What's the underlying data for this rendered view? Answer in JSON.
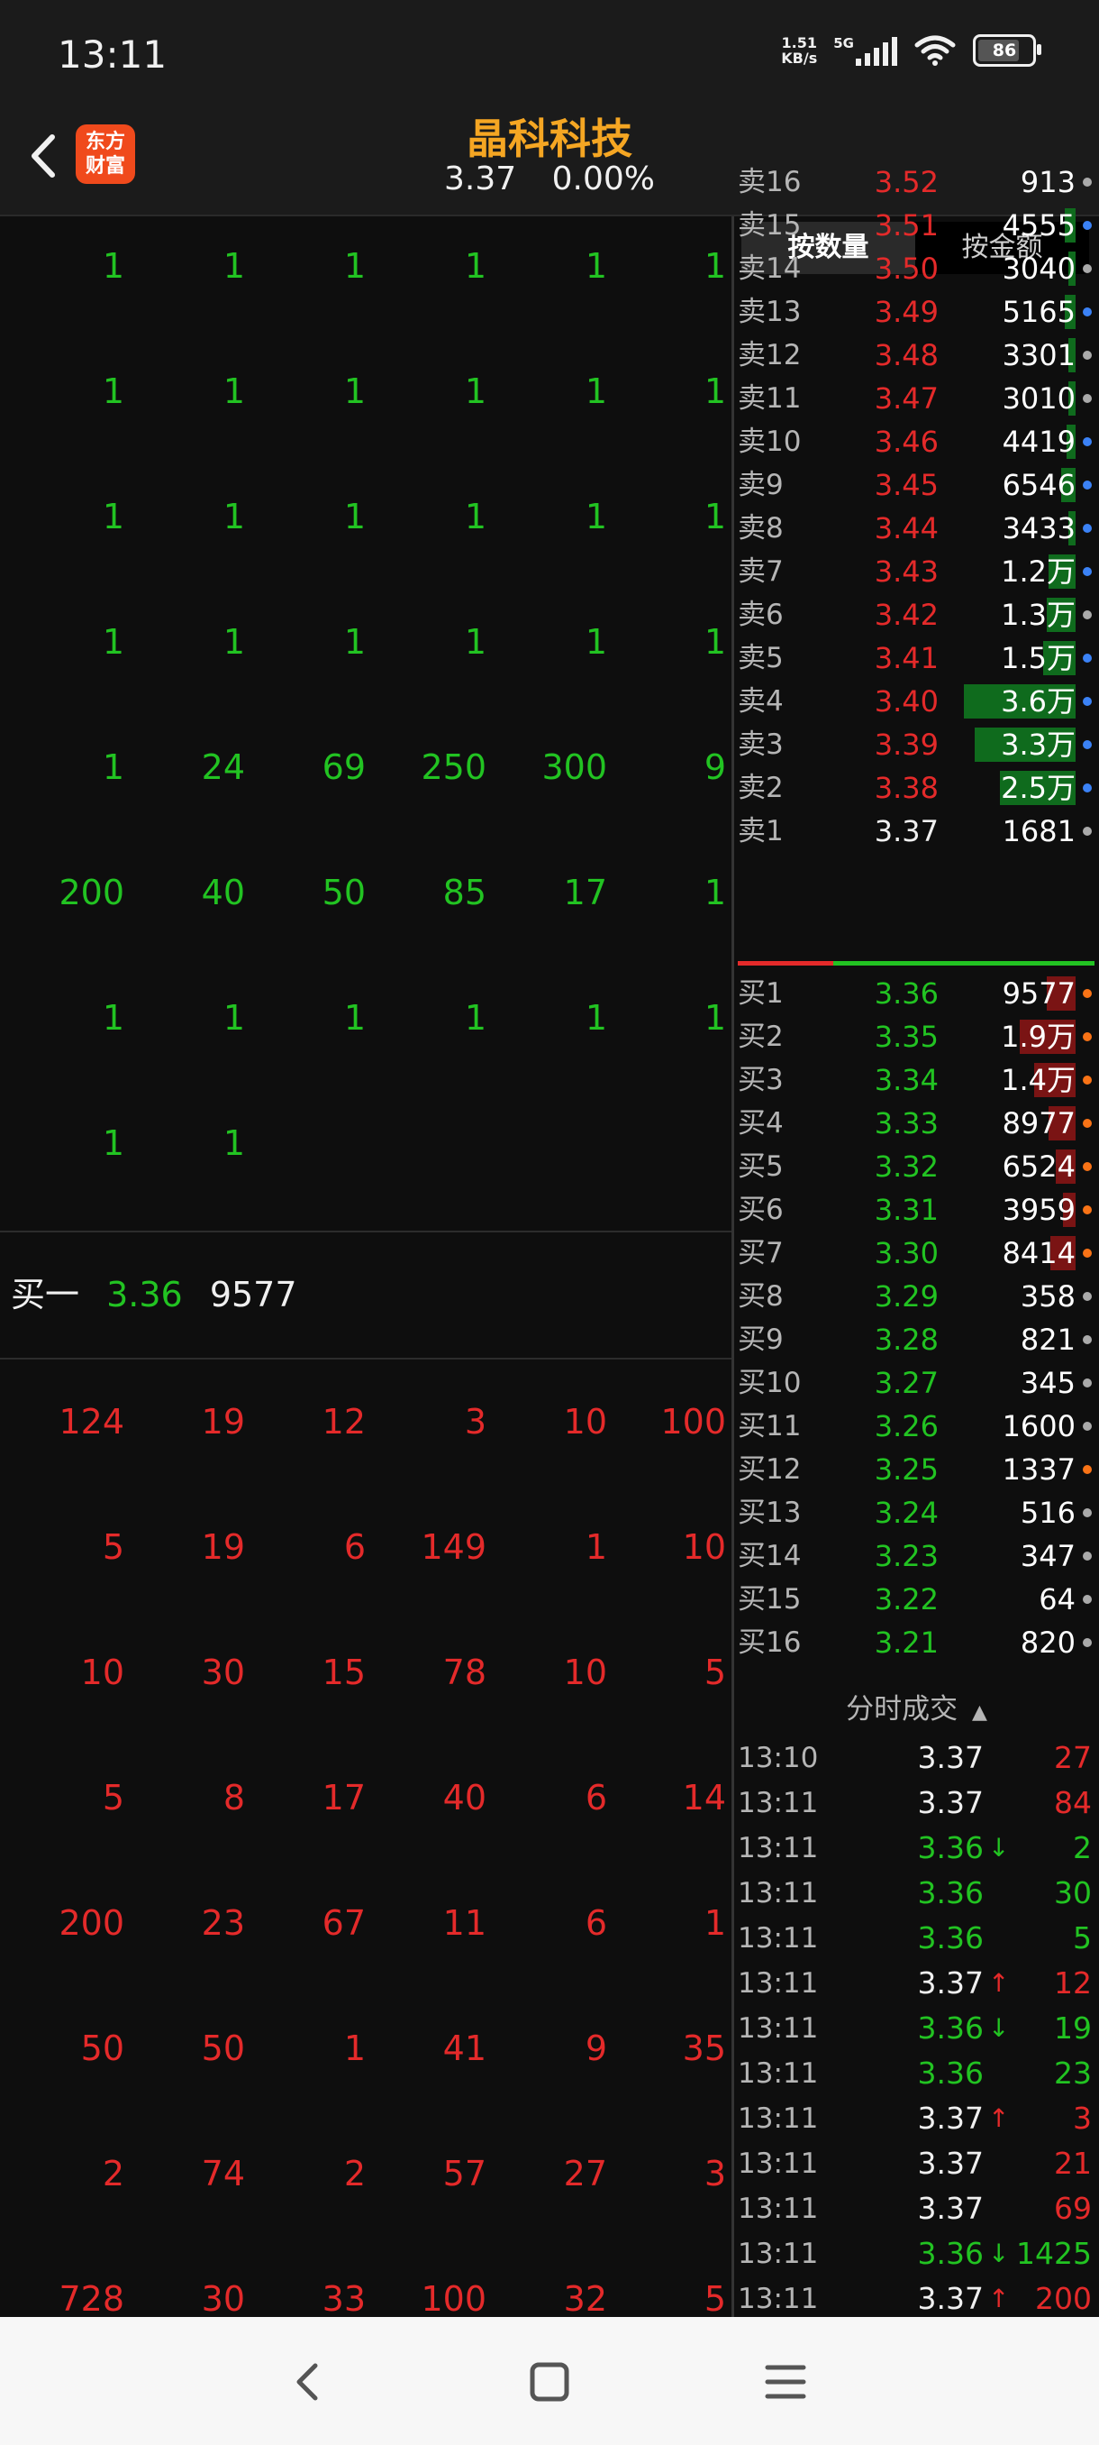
{
  "status": {
    "time": "13:11",
    "net_speed_top": "1.51",
    "net_speed_bottom": "KB/s",
    "network": "5G",
    "battery": "86"
  },
  "header": {
    "logo_line1": "东方",
    "logo_line2": "财富",
    "title": "晶科科技",
    "price": "3.37",
    "change": "0.00%"
  },
  "sell_queue": [
    [
      "1",
      "1",
      "1",
      "1",
      "1",
      "1"
    ],
    [
      "1",
      "1",
      "1",
      "1",
      "1",
      "1"
    ],
    [
      "1",
      "1",
      "1",
      "1",
      "1",
      "1"
    ],
    [
      "1",
      "1",
      "1",
      "1",
      "1",
      "1"
    ],
    [
      "1",
      "24",
      "69",
      "250",
      "300",
      "9"
    ],
    [
      "200",
      "40",
      "50",
      "85",
      "17",
      "1"
    ],
    [
      "1",
      "1",
      "1",
      "1",
      "1",
      "1"
    ],
    [
      "1",
      "1"
    ]
  ],
  "buy_one": {
    "label": "买一",
    "price": "3.36",
    "volume": "9577"
  },
  "buy_queue": [
    [
      "124",
      "19",
      "12",
      "3",
      "10",
      "100"
    ],
    [
      "5",
      "19",
      "6",
      "149",
      "1",
      "10"
    ],
    [
      "10",
      "30",
      "15",
      "78",
      "10",
      "5"
    ],
    [
      "5",
      "8",
      "17",
      "40",
      "6",
      "14"
    ],
    [
      "200",
      "23",
      "67",
      "11",
      "6",
      "1"
    ],
    [
      "50",
      "50",
      "1",
      "41",
      "9",
      "35"
    ],
    [
      "2",
      "74",
      "2",
      "57",
      "27",
      "3"
    ],
    [
      "728",
      "30",
      "33",
      "100",
      "32",
      "5"
    ]
  ],
  "tabs": {
    "by_quantity": "按数量",
    "by_amount": "按金额"
  },
  "asks": [
    {
      "label": "卖16",
      "price": "3.52",
      "volume": "913",
      "bar": 0.0,
      "dot": "#aaaaaa"
    },
    {
      "label": "卖15",
      "price": "3.51",
      "volume": "4555",
      "bar": 0.06,
      "dot": "#3b82f6"
    },
    {
      "label": "卖14",
      "price": "3.50",
      "volume": "3040",
      "bar": 0.04,
      "dot": "#aaaaaa"
    },
    {
      "label": "卖13",
      "price": "3.49",
      "volume": "5165",
      "bar": 0.06,
      "dot": "#3b82f6"
    },
    {
      "label": "卖12",
      "price": "3.48",
      "volume": "3301",
      "bar": 0.04,
      "dot": "#aaaaaa"
    },
    {
      "label": "卖11",
      "price": "3.47",
      "volume": "3010",
      "bar": 0.04,
      "dot": "#aaaaaa"
    },
    {
      "label": "卖10",
      "price": "3.46",
      "volume": "4419",
      "bar": 0.05,
      "dot": "#3b82f6"
    },
    {
      "label": "卖9",
      "price": "3.45",
      "volume": "6546",
      "bar": 0.08,
      "dot": "#3b82f6"
    },
    {
      "label": "卖8",
      "price": "3.44",
      "volume": "3433",
      "bar": 0.04,
      "dot": "#3b82f6"
    },
    {
      "label": "卖7",
      "price": "3.43",
      "volume": "1.2万",
      "bar": 0.15,
      "dot": "#3b82f6"
    },
    {
      "label": "卖6",
      "price": "3.42",
      "volume": "1.3万",
      "bar": 0.16,
      "dot": "#aaaaaa"
    },
    {
      "label": "卖5",
      "price": "3.41",
      "volume": "1.5万",
      "bar": 0.18,
      "dot": "#3b82f6"
    },
    {
      "label": "卖4",
      "price": "3.40",
      "volume": "3.6万",
      "bar": 0.62,
      "dot": "#3b82f6"
    },
    {
      "label": "卖3",
      "price": "3.39",
      "volume": "3.3万",
      "bar": 0.56,
      "dot": "#3b82f6"
    },
    {
      "label": "卖2",
      "price": "3.38",
      "volume": "2.5万",
      "bar": 0.42,
      "dot": "#3b82f6"
    },
    {
      "label": "卖1",
      "price": "3.37",
      "volume": "1681",
      "bar": 0.0,
      "dot": "#aaaaaa"
    }
  ],
  "bids": [
    {
      "label": "买1",
      "price": "3.36",
      "volume": "9577",
      "bar": 0.16,
      "dot": "#f97316"
    },
    {
      "label": "买2",
      "price": "3.35",
      "volume": "1.9万",
      "bar": 0.31,
      "dot": "#f97316"
    },
    {
      "label": "买3",
      "price": "3.34",
      "volume": "1.4万",
      "bar": 0.23,
      "dot": "#f97316"
    },
    {
      "label": "买4",
      "price": "3.33",
      "volume": "8977",
      "bar": 0.15,
      "dot": "#f97316"
    },
    {
      "label": "买5",
      "price": "3.32",
      "volume": "6524",
      "bar": 0.11,
      "dot": "#f97316"
    },
    {
      "label": "买6",
      "price": "3.31",
      "volume": "3959",
      "bar": 0.07,
      "dot": "#f97316"
    },
    {
      "label": "买7",
      "price": "3.30",
      "volume": "8414",
      "bar": 0.14,
      "dot": "#f97316"
    },
    {
      "label": "买8",
      "price": "3.29",
      "volume": "358",
      "bar": 0.0,
      "dot": "#aaaaaa"
    },
    {
      "label": "买9",
      "price": "3.28",
      "volume": "821",
      "bar": 0.0,
      "dot": "#aaaaaa"
    },
    {
      "label": "买10",
      "price": "3.27",
      "volume": "345",
      "bar": 0.0,
      "dot": "#aaaaaa"
    },
    {
      "label": "买11",
      "price": "3.26",
      "volume": "1600",
      "bar": 0.0,
      "dot": "#aaaaaa"
    },
    {
      "label": "买12",
      "price": "3.25",
      "volume": "1337",
      "bar": 0.0,
      "dot": "#f97316"
    },
    {
      "label": "买13",
      "price": "3.24",
      "volume": "516",
      "bar": 0.0,
      "dot": "#aaaaaa"
    },
    {
      "label": "买14",
      "price": "3.23",
      "volume": "347",
      "bar": 0.0,
      "dot": "#aaaaaa"
    },
    {
      "label": "买15",
      "price": "3.22",
      "volume": "64",
      "bar": 0.0,
      "dot": "#aaaaaa"
    },
    {
      "label": "买16",
      "price": "3.21",
      "volume": "820",
      "bar": 0.0,
      "dot": "#aaaaaa"
    }
  ],
  "ticks_header": "分时成交",
  "ticks": [
    {
      "time": "13:10",
      "price": "3.37",
      "arrow": "",
      "volume": "27",
      "price_color": "white",
      "vol_color": "red"
    },
    {
      "time": "13:11",
      "price": "3.37",
      "arrow": "",
      "volume": "84",
      "price_color": "white",
      "vol_color": "red"
    },
    {
      "time": "13:11",
      "price": "3.36",
      "arrow": "↓",
      "volume": "2",
      "price_color": "green",
      "vol_color": "green"
    },
    {
      "time": "13:11",
      "price": "3.36",
      "arrow": "",
      "volume": "30",
      "price_color": "green",
      "vol_color": "green"
    },
    {
      "time": "13:11",
      "price": "3.36",
      "arrow": "",
      "volume": "5",
      "price_color": "green",
      "vol_color": "green"
    },
    {
      "time": "13:11",
      "price": "3.37",
      "arrow": "↑",
      "volume": "12",
      "price_color": "white",
      "vol_color": "red"
    },
    {
      "time": "13:11",
      "price": "3.36",
      "arrow": "↓",
      "volume": "19",
      "price_color": "green",
      "vol_color": "green"
    },
    {
      "time": "13:11",
      "price": "3.36",
      "arrow": "",
      "volume": "23",
      "price_color": "green",
      "vol_color": "green"
    },
    {
      "time": "13:11",
      "price": "3.37",
      "arrow": "↑",
      "volume": "3",
      "price_color": "white",
      "vol_color": "red"
    },
    {
      "time": "13:11",
      "price": "3.37",
      "arrow": "",
      "volume": "21",
      "price_color": "white",
      "vol_color": "red"
    },
    {
      "time": "13:11",
      "price": "3.37",
      "arrow": "",
      "volume": "69",
      "price_color": "white",
      "vol_color": "red"
    },
    {
      "time": "13:11",
      "price": "3.36",
      "arrow": "↓",
      "volume": "1425",
      "price_color": "green",
      "vol_color": "green"
    },
    {
      "time": "13:11",
      "price": "3.37",
      "arrow": "↑",
      "volume": "200",
      "price_color": "white",
      "vol_color": "red"
    }
  ],
  "nav": {
    "back": "back-icon",
    "home": "home-icon",
    "menu": "menu-icon"
  }
}
